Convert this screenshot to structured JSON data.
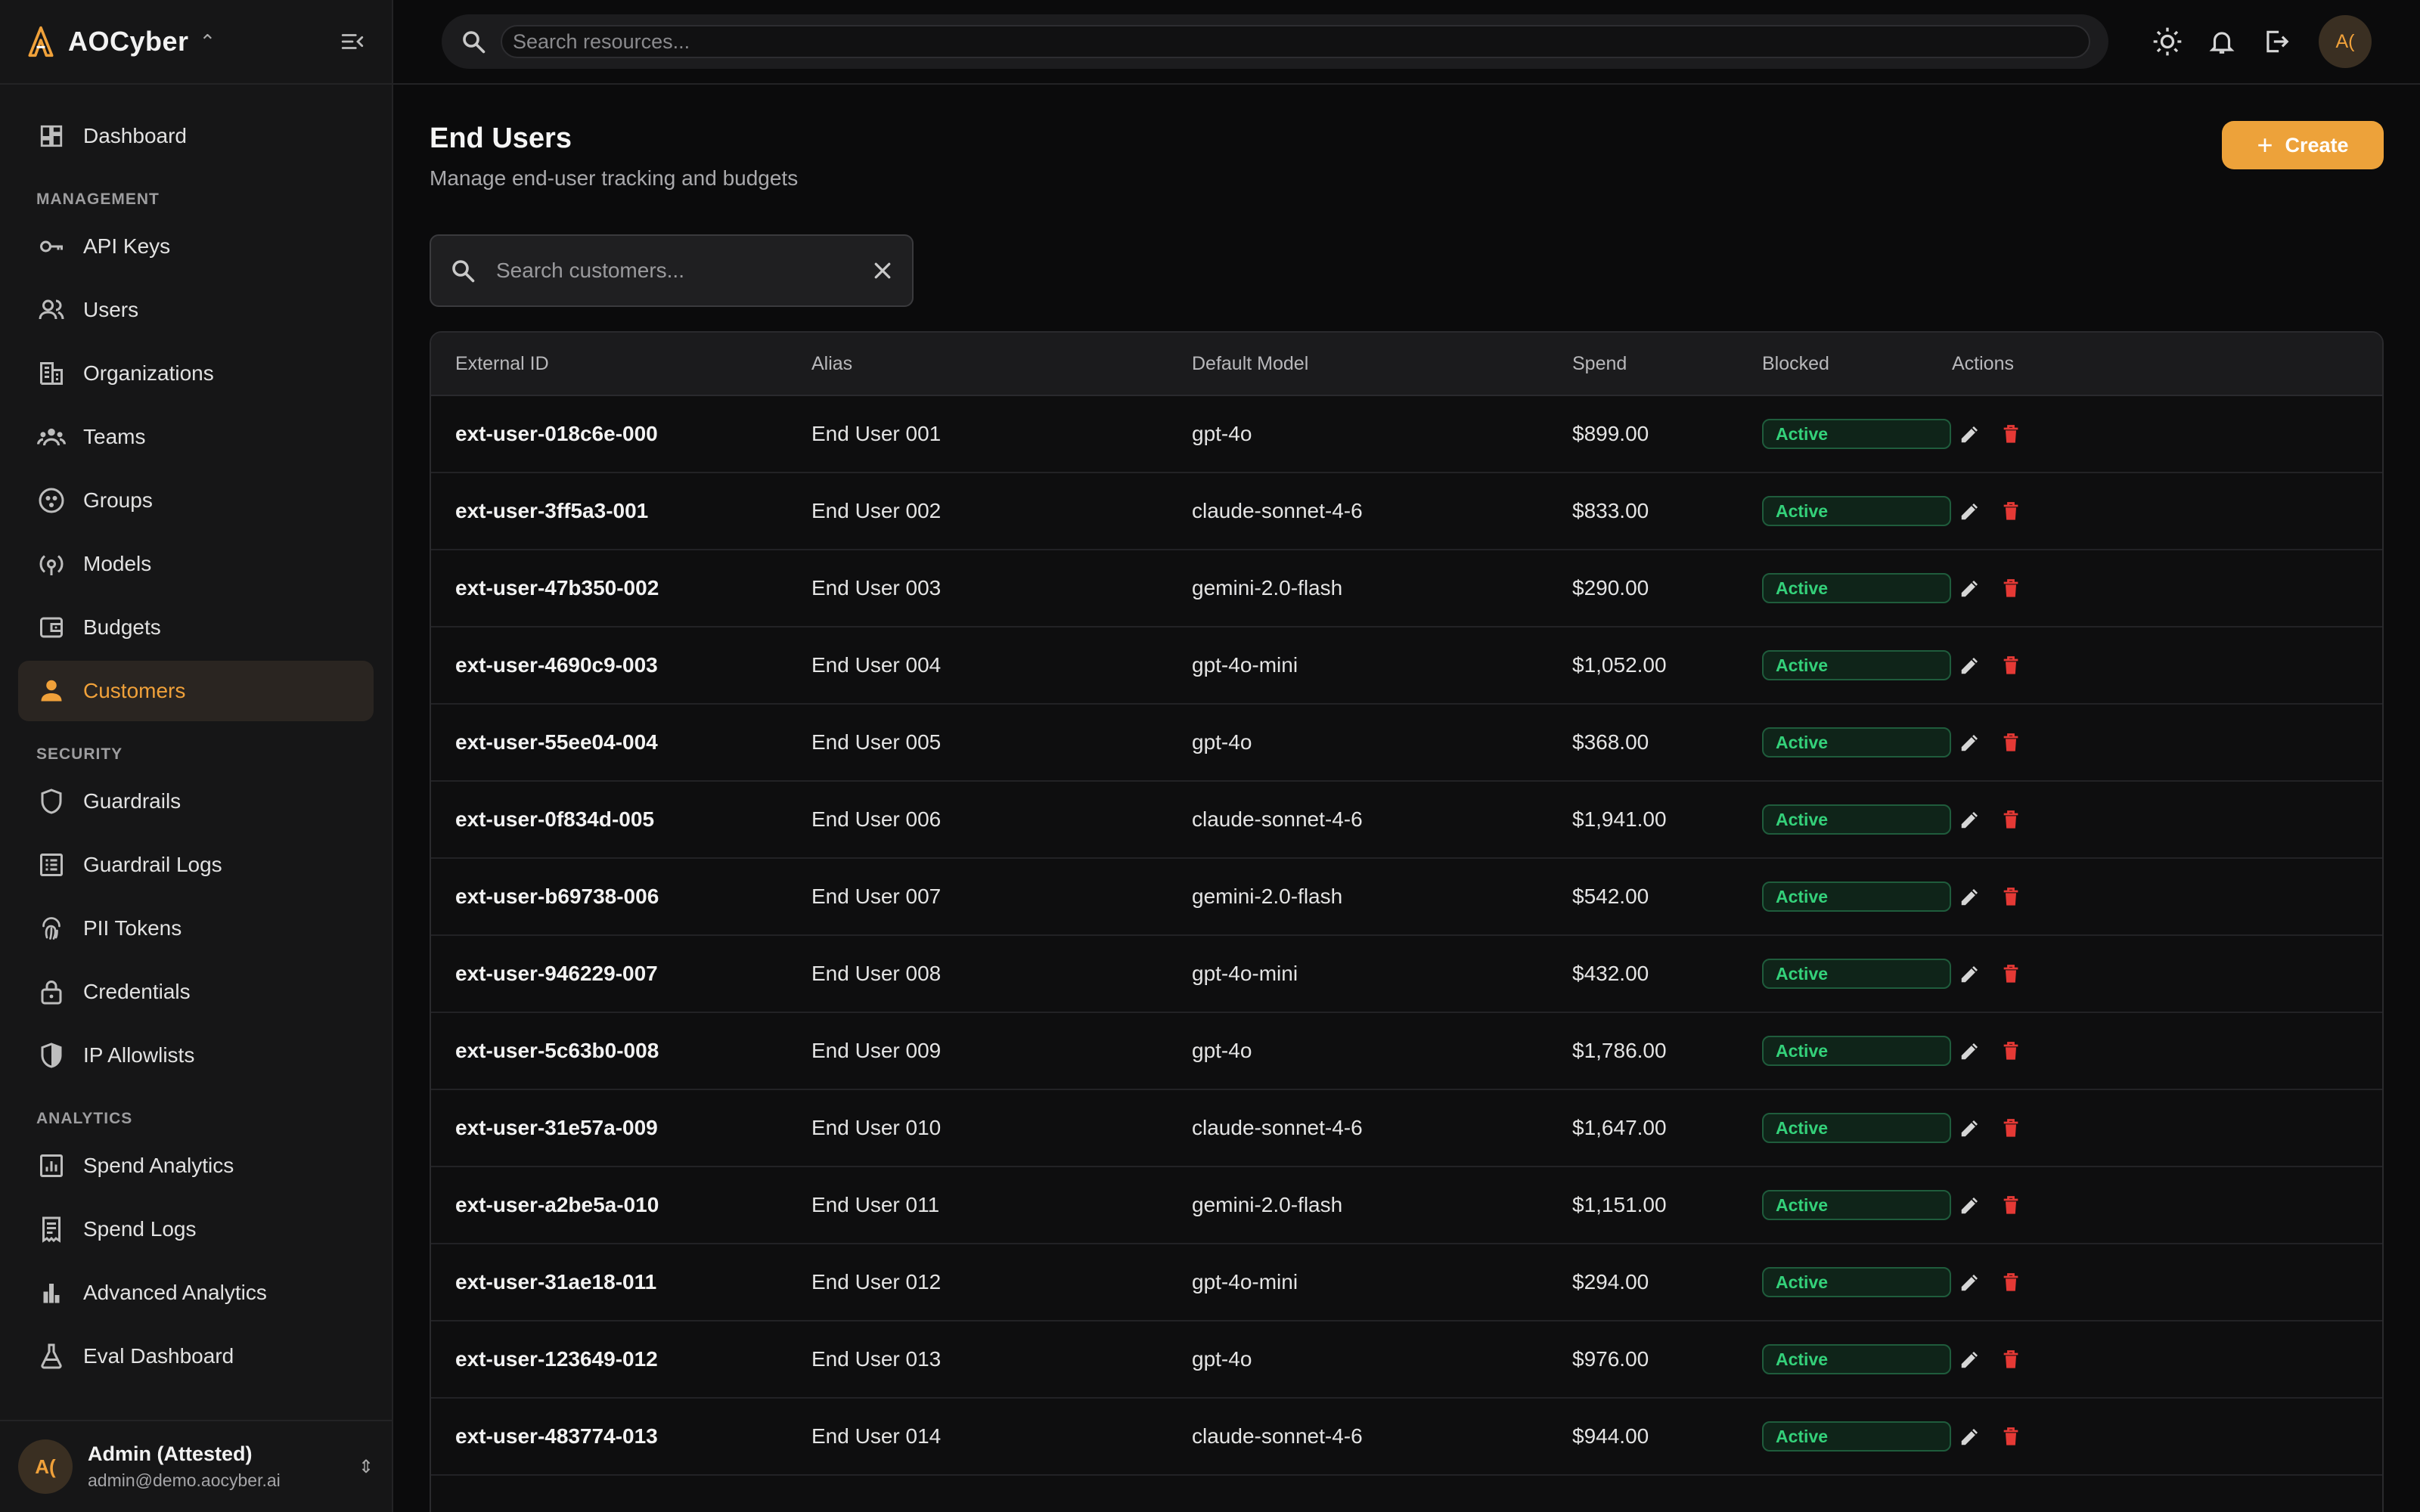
{
  "app": {
    "brand": "AOCyber"
  },
  "sidebar": {
    "top_item": {
      "label": "Dashboard",
      "icon": "dashboard-icon"
    },
    "sections": [
      {
        "label": "MANAGEMENT",
        "items": [
          {
            "label": "API Keys",
            "icon": "key-icon"
          },
          {
            "label": "Users",
            "icon": "users-icon"
          },
          {
            "label": "Organizations",
            "icon": "building-icon"
          },
          {
            "label": "Teams",
            "icon": "teams-icon"
          },
          {
            "label": "Groups",
            "icon": "groups-icon"
          },
          {
            "label": "Models",
            "icon": "models-icon"
          },
          {
            "label": "Budgets",
            "icon": "wallet-icon"
          },
          {
            "label": "Customers",
            "icon": "person-icon",
            "active": true
          }
        ]
      },
      {
        "label": "SECURITY",
        "items": [
          {
            "label": "Guardrails",
            "icon": "shield-icon"
          },
          {
            "label": "Guardrail Logs",
            "icon": "list-icon"
          },
          {
            "label": "PII Tokens",
            "icon": "fingerprint-icon"
          },
          {
            "label": "Credentials",
            "icon": "lock-icon"
          },
          {
            "label": "IP Allowlists",
            "icon": "shield-half-icon"
          }
        ]
      },
      {
        "label": "ANALYTICS",
        "items": [
          {
            "label": "Spend Analytics",
            "icon": "chart-box-icon"
          },
          {
            "label": "Spend Logs",
            "icon": "receipt-icon"
          },
          {
            "label": "Advanced Analytics",
            "icon": "bar-chart-icon"
          },
          {
            "label": "Eval Dashboard",
            "icon": "flask-icon"
          }
        ]
      }
    ],
    "user": {
      "initials": "A(",
      "name": "Admin (Attested)",
      "email": "admin@demo.aocyber.ai"
    }
  },
  "topbar": {
    "search_placeholder": "Search resources...",
    "avatar_initials": "A("
  },
  "page": {
    "title": "End Users",
    "subtitle": "Manage end-user tracking and budgets",
    "create_label": "Create",
    "search_placeholder": "Search customers..."
  },
  "table": {
    "columns": [
      "External ID",
      "Alias",
      "Default Model",
      "Spend",
      "Blocked",
      "Actions"
    ],
    "rows": [
      {
        "id": "ext-user-018c6e-000",
        "alias": "End User 001",
        "model": "gpt-4o",
        "spend": "$899.00",
        "status": "Active"
      },
      {
        "id": "ext-user-3ff5a3-001",
        "alias": "End User 002",
        "model": "claude-sonnet-4-6",
        "spend": "$833.00",
        "status": "Active"
      },
      {
        "id": "ext-user-47b350-002",
        "alias": "End User 003",
        "model": "gemini-2.0-flash",
        "spend": "$290.00",
        "status": "Active"
      },
      {
        "id": "ext-user-4690c9-003",
        "alias": "End User 004",
        "model": "gpt-4o-mini",
        "spend": "$1,052.00",
        "status": "Active"
      },
      {
        "id": "ext-user-55ee04-004",
        "alias": "End User 005",
        "model": "gpt-4o",
        "spend": "$368.00",
        "status": "Active"
      },
      {
        "id": "ext-user-0f834d-005",
        "alias": "End User 006",
        "model": "claude-sonnet-4-6",
        "spend": "$1,941.00",
        "status": "Active"
      },
      {
        "id": "ext-user-b69738-006",
        "alias": "End User 007",
        "model": "gemini-2.0-flash",
        "spend": "$542.00",
        "status": "Active"
      },
      {
        "id": "ext-user-946229-007",
        "alias": "End User 008",
        "model": "gpt-4o-mini",
        "spend": "$432.00",
        "status": "Active"
      },
      {
        "id": "ext-user-5c63b0-008",
        "alias": "End User 009",
        "model": "gpt-4o",
        "spend": "$1,786.00",
        "status": "Active"
      },
      {
        "id": "ext-user-31e57a-009",
        "alias": "End User 010",
        "model": "claude-sonnet-4-6",
        "spend": "$1,647.00",
        "status": "Active"
      },
      {
        "id": "ext-user-a2be5a-010",
        "alias": "End User 011",
        "model": "gemini-2.0-flash",
        "spend": "$1,151.00",
        "status": "Active"
      },
      {
        "id": "ext-user-31ae18-011",
        "alias": "End User 012",
        "model": "gpt-4o-mini",
        "spend": "$294.00",
        "status": "Active"
      },
      {
        "id": "ext-user-123649-012",
        "alias": "End User 013",
        "model": "gpt-4o",
        "spend": "$976.00",
        "status": "Active"
      },
      {
        "id": "ext-user-483774-013",
        "alias": "End User 014",
        "model": "claude-sonnet-4-6",
        "spend": "$944.00",
        "status": "Active"
      }
    ]
  },
  "colors": {
    "accent": "#eda23a",
    "active_badge": "#34d17a",
    "delete": "#e53935"
  }
}
